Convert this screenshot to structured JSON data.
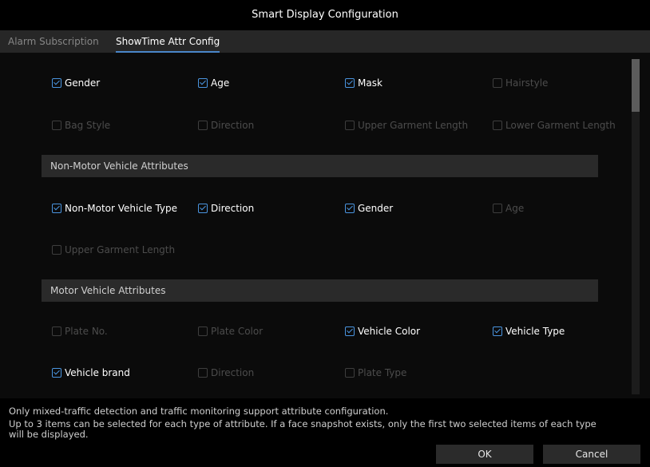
{
  "dialog": {
    "title": "Smart Display Configuration"
  },
  "tabs": [
    {
      "label": "Alarm Subscription",
      "active": false
    },
    {
      "label": "ShowTime Attr Config",
      "active": true
    }
  ],
  "face_rows": [
    [
      {
        "label": "Gender",
        "checked": true
      },
      {
        "label": "Age",
        "checked": true
      },
      {
        "label": "Mask",
        "checked": true
      },
      {
        "label": "Hairstyle",
        "checked": false
      }
    ],
    [
      {
        "label": "Bag Style",
        "checked": false
      },
      {
        "label": "Direction",
        "checked": false
      },
      {
        "label": "Upper Garment Length",
        "checked": false
      },
      {
        "label": "Lower Garment Length",
        "checked": false
      }
    ]
  ],
  "non_motor": {
    "title": "Non-Motor Vehicle Attributes",
    "rows": [
      [
        {
          "label": "Non-Motor Vehicle Type",
          "checked": true
        },
        {
          "label": "Direction",
          "checked": true
        },
        {
          "label": "Gender",
          "checked": true
        },
        {
          "label": "Age",
          "checked": false
        }
      ],
      [
        {
          "label": "Upper Garment Length",
          "checked": false
        }
      ]
    ]
  },
  "motor": {
    "title": "Motor Vehicle Attributes",
    "rows": [
      [
        {
          "label": "Plate No.",
          "checked": false
        },
        {
          "label": "Plate Color",
          "checked": false
        },
        {
          "label": "Vehicle Color",
          "checked": true
        },
        {
          "label": "Vehicle Type",
          "checked": true
        }
      ],
      [
        {
          "label": "Vehicle brand",
          "checked": true
        },
        {
          "label": "Direction",
          "checked": false
        },
        {
          "label": "Plate Type",
          "checked": false
        }
      ]
    ]
  },
  "footer": {
    "note_line1": "Only mixed-traffic detection and traffic monitoring support attribute configuration.",
    "note_line2": "Up to 3 items can be selected for each type of attribute. If a face snapshot exists, only the first two selected items of each type",
    "note_line3": "will be displayed.",
    "ok_label": "OK",
    "cancel_label": "Cancel"
  },
  "colors": {
    "accent": "#4a95e0",
    "background": "#000000",
    "section_bar": "#2a2a2a"
  }
}
